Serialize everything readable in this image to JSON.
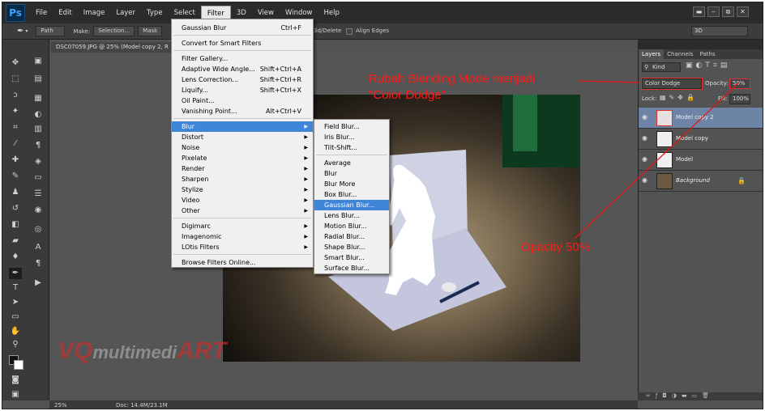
{
  "menubar": {
    "logo": "Ps",
    "items": [
      "File",
      "Edit",
      "Image",
      "Layer",
      "Type",
      "Select",
      "Filter",
      "3D",
      "View",
      "Window",
      "Help"
    ]
  },
  "window_controls": [
    "▬",
    "‒",
    "⧉",
    "✕"
  ],
  "options": {
    "mode": "Path",
    "make_label": "Make:",
    "selection_btn": "Selection...",
    "mask_btn": "Mask",
    "shape_fragment": "...",
    "bd_delete": "3d/Delete",
    "align_edges": "Align Edges",
    "workspace": "3D"
  },
  "document": {
    "tab_title": "DSC07059.JPG @ 25% (Model copy 2, R",
    "zoom": "25%",
    "doc_info": "Doc: 14.4M/23.1M"
  },
  "filter_menu": {
    "items": [
      {
        "label": "Gaussian Blur",
        "shortcut": "Ctrl+F"
      },
      {
        "label": "Convert for Smart Filters",
        "shortcut": ""
      },
      {
        "label": "Filter Gallery...",
        "shortcut": ""
      },
      {
        "label": "Adaptive Wide Angle...",
        "shortcut": "Shift+Ctrl+A"
      },
      {
        "label": "Lens Correction...",
        "shortcut": "Shift+Ctrl+R"
      },
      {
        "label": "Liquify...",
        "shortcut": "Shift+Ctrl+X"
      },
      {
        "label": "Oil Paint...",
        "shortcut": ""
      },
      {
        "label": "Vanishing Point...",
        "shortcut": "Alt+Ctrl+V"
      },
      {
        "label": "Blur",
        "shortcut": ""
      },
      {
        "label": "Distort",
        "shortcut": ""
      },
      {
        "label": "Noise",
        "shortcut": ""
      },
      {
        "label": "Pixelate",
        "shortcut": ""
      },
      {
        "label": "Render",
        "shortcut": ""
      },
      {
        "label": "Sharpen",
        "shortcut": ""
      },
      {
        "label": "Stylize",
        "shortcut": ""
      },
      {
        "label": "Video",
        "shortcut": ""
      },
      {
        "label": "Other",
        "shortcut": ""
      },
      {
        "label": "Digimarc",
        "shortcut": ""
      },
      {
        "label": "Imagenomic",
        "shortcut": ""
      },
      {
        "label": "LOtis Filters",
        "shortcut": ""
      },
      {
        "label": "Browse Filters Online...",
        "shortcut": ""
      }
    ]
  },
  "blur_submenu": {
    "items": [
      "Field Blur...",
      "Iris Blur...",
      "Tilt-Shift...",
      "Average",
      "Blur",
      "Blur More",
      "Box Blur...",
      "Gaussian Blur...",
      "Lens Blur...",
      "Motion Blur...",
      "Radial Blur...",
      "Shape Blur...",
      "Smart Blur...",
      "Surface Blur..."
    ]
  },
  "layers_panel": {
    "tabs": [
      "Layers",
      "Channels",
      "Paths"
    ],
    "kind_label": "Kind",
    "blend_mode": "Color Dodge",
    "opacity_label": "Opacity:",
    "opacity_value": "50%",
    "lock_label": "Lock:",
    "fill_label": "Fill:",
    "fill_value": "100%",
    "layers": [
      {
        "name": "Model copy 2",
        "selected": true
      },
      {
        "name": "Model copy",
        "selected": false
      },
      {
        "name": "Model",
        "selected": false
      },
      {
        "name": "Background",
        "selected": false
      }
    ]
  },
  "annotations": {
    "blend_line1": "Rubah Blending Mode menjadi",
    "blend_line2": "\"Color Dodge\"",
    "opacity": "Opacity 50%"
  },
  "watermark": {
    "part1": "VQ",
    "part2": "multimedi",
    "part3": "ART"
  },
  "colors": {
    "accent_highlight": "#3f85d8",
    "annotation_red": "#ff1a1a",
    "selected_layer": "#6d84a6"
  }
}
